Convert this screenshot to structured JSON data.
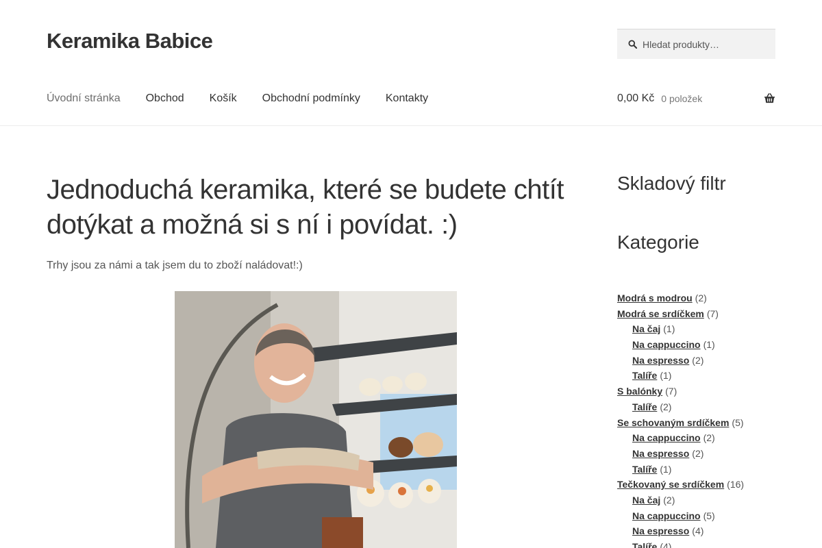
{
  "site": {
    "title": "Keramika Babice"
  },
  "search": {
    "placeholder": "Hledat produkty…"
  },
  "nav": {
    "items": [
      {
        "label": "Úvodní stránka"
      },
      {
        "label": "Obchod"
      },
      {
        "label": "Košík"
      },
      {
        "label": "Obchodní podmínky"
      },
      {
        "label": "Kontakty"
      }
    ]
  },
  "cart": {
    "amount": "0,00 Kč",
    "count": "0 položek"
  },
  "main": {
    "title": "Jednoduchá keramika, které se budete chtít dotýkat a možná si s ní i povídat. :)",
    "intro": "Trhy jsou za námi a tak jsem du to zboží naládovat!:)"
  },
  "sidebar": {
    "stock_filter_title": "Skladový filtr",
    "categories_title": "Kategorie",
    "categories": [
      {
        "name": "Modrá s modrou",
        "count": "(2)"
      },
      {
        "name": "Modrá se srdíčkem",
        "count": "(7)"
      },
      {
        "name": "Na čaj",
        "count": "(1)"
      },
      {
        "name": "Na cappuccino",
        "count": "(1)"
      },
      {
        "name": "Na espresso",
        "count": "(2)"
      },
      {
        "name": "Talíře",
        "count": "(1)"
      },
      {
        "name": "S balónky",
        "count": "(7)"
      },
      {
        "name": "Talíře",
        "count": "(2)"
      },
      {
        "name": "Se schovaným srdíčkem",
        "count": "(5)"
      },
      {
        "name": "Na cappuccino",
        "count": "(2)"
      },
      {
        "name": "Na espresso",
        "count": "(2)"
      },
      {
        "name": "Talíře",
        "count": "(1)"
      },
      {
        "name": "Tečkovaný se srdíčkem",
        "count": "(16)"
      },
      {
        "name": "Na čaj",
        "count": "(2)"
      },
      {
        "name": "Na cappuccino",
        "count": "(5)"
      },
      {
        "name": "Na espresso",
        "count": "(4)"
      },
      {
        "name": "Talíře",
        "count": "(4)"
      }
    ]
  },
  "icons": {
    "search": "search-icon",
    "cart": "shopping-basket-icon"
  },
  "colors": {
    "text": "#333333",
    "muted": "#6d6d6d",
    "search_bg": "#f2f2f2"
  }
}
